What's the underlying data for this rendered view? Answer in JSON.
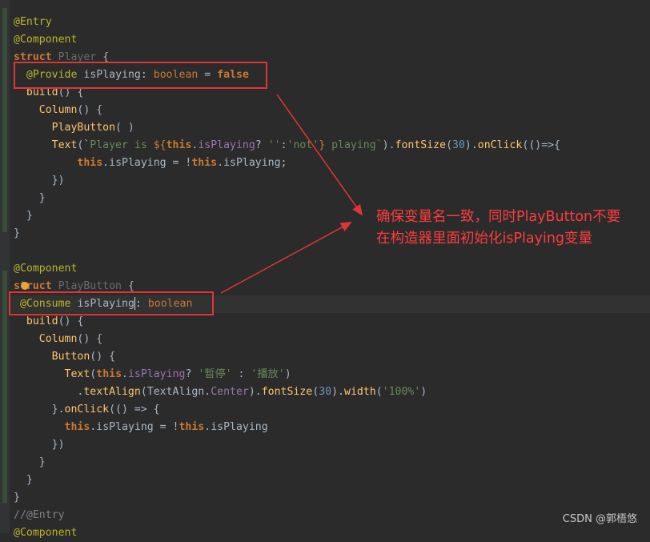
{
  "code": {
    "l1": {
      "ann": "@Entry"
    },
    "l2": {
      "ann": "@Component"
    },
    "l3": {
      "kw": "struct",
      "name": "Player",
      "brace": "{"
    },
    "l4": {
      "ann": "@Provide",
      "name": "isPlaying",
      "colon": ":",
      "type": "boolean",
      "eq": "=",
      "val": "false"
    },
    "l5": {
      "fn": "build",
      "paren": "()",
      "brace": "{"
    },
    "l6": {
      "fn": "Column",
      "paren": "()",
      "brace": "{"
    },
    "l7": {
      "fn": "PlayButton",
      "paren": "( )"
    },
    "l8": {
      "fn": "Text",
      "p1": "(`",
      "s1": "Player is ",
      "s2": "${",
      "kw1": "this",
      "s3": ".",
      "prop1": "isPlaying",
      "s4": "? ",
      "s5": "''",
      "s6": ":",
      "s7": "'not'",
      "s8": "}",
      "s9": " playing`",
      "p2": ").",
      "fn2": "fontSize",
      "p3": "(",
      "num": "30",
      "p4": ").",
      "fn3": "onClick",
      "p5": "(()=>{"
    },
    "l9": {
      "kw1": "this",
      "dot1": ".",
      "prop1": "isPlaying",
      "eq": " = !",
      "kw2": "this",
      "dot2": ".",
      "prop2": "isPlaying",
      "semi": ";"
    },
    "l10": {
      "t": "})"
    },
    "l11": {
      "t": "}"
    },
    "l12": {
      "t": "}"
    },
    "l13": {
      "t": "}"
    },
    "l14": {
      "ann": "@Component"
    },
    "l15": {
      "kw": "struct",
      "name": "PlayButton",
      "brace": "{"
    },
    "l16": {
      "ann": "@Consume",
      "name1": "isPlaying",
      "colon": ":",
      "type": "boolean"
    },
    "l17": {
      "fn": "build",
      "paren": "()",
      "brace": "{"
    },
    "l18": {
      "fn": "Column",
      "paren": "()",
      "brace": "{"
    },
    "l19": {
      "fn": "Button",
      "paren": "()",
      "brace": "{"
    },
    "l20": {
      "fn": "Text",
      "p1": "(",
      "kw": "this",
      "dot": ".",
      "prop": "isPlaying",
      "q": "? ",
      "s1": "'暂停'",
      "c": " : ",
      "s2": "'播放'",
      "p2": ")"
    },
    "l21": {
      "dot1": ".",
      "fn1": "textAlign",
      "p1": "(",
      "cls": "TextAlign",
      "dot2": ".",
      "prop": "Center",
      "p2": ").",
      "fn2": "fontSize",
      "p3": "(",
      "num": "30",
      "p4": ").",
      "fn3": "width",
      "p5": "(",
      "str": "'100%'",
      "p6": ")"
    },
    "l22": {
      "t1": "}.",
      "fn": "onClick",
      "t2": "(() => {"
    },
    "l23": {
      "kw1": "this",
      "dot1": ".",
      "prop1": "isPlaying",
      "eq": " = !",
      "kw2": "this",
      "dot2": ".",
      "prop2": "isPlaying"
    },
    "l24": {
      "t": "})"
    },
    "l25": {
      "t": "}"
    },
    "l26": {
      "t": "}"
    },
    "l27": {
      "t": "}"
    },
    "l28": {
      "cmt": "//@Entry"
    },
    "l29": {
      "ann": "@Component"
    }
  },
  "annotation": {
    "line1": "确保变量名一致，同时PlayButton不要",
    "line2": "在构造器里面初始化isPlaying变量"
  },
  "watermark": "CSDN @郭梧悠",
  "colors": {
    "background": "#2b2b2b",
    "annotation_red": "#e13535",
    "keyword": "#cc7832",
    "annotation_token": "#bbb529",
    "function": "#ffc66d",
    "string": "#6a8759",
    "number": "#6897bb",
    "property": "#9876aa"
  },
  "icons": {
    "gutter_bulb": "lightbulb-icon"
  }
}
